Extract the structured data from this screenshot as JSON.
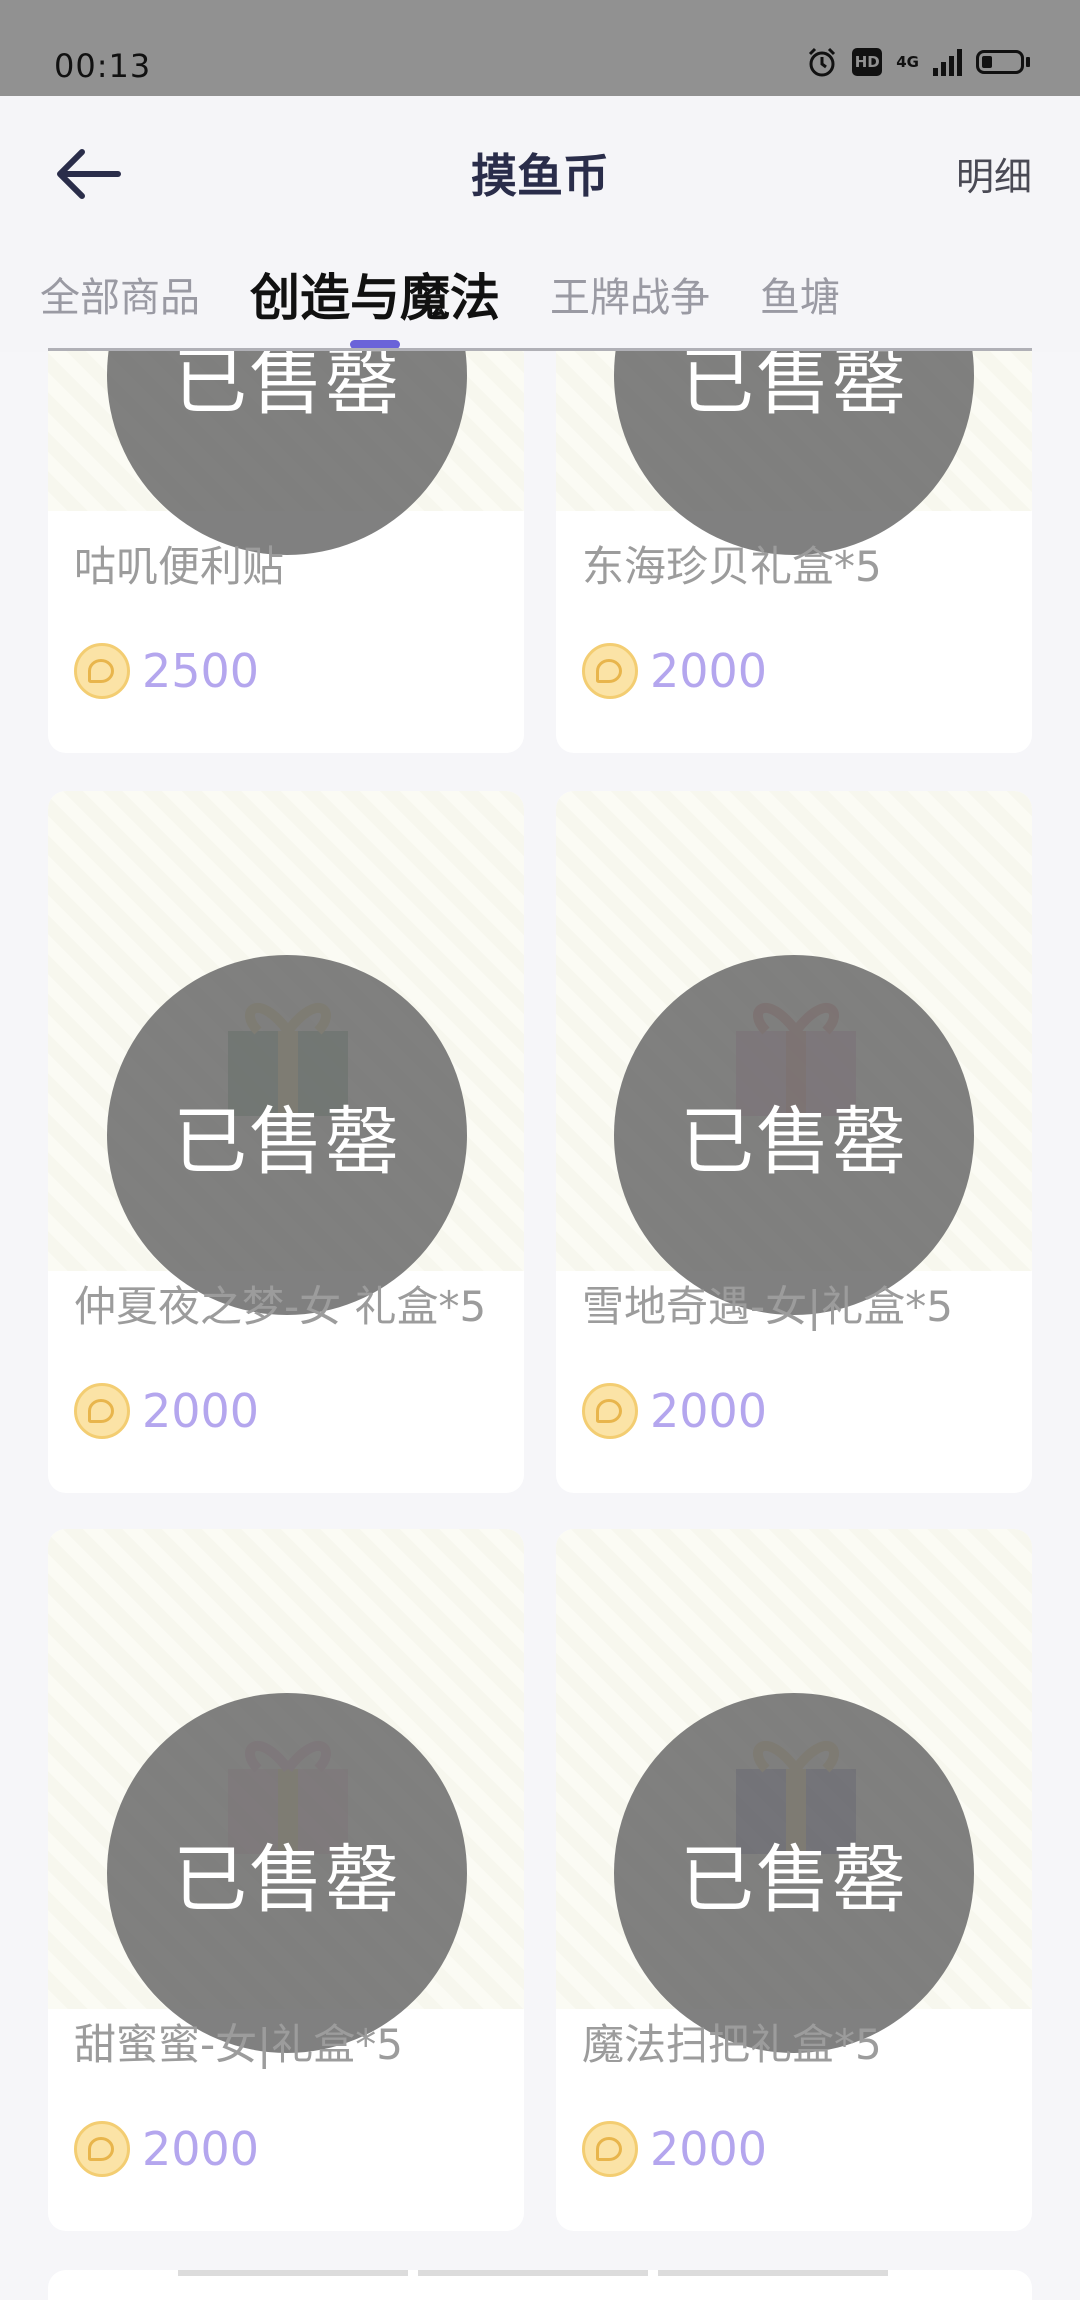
{
  "status_bar": {
    "time": "00:13",
    "hd": "HD",
    "network": "4G"
  },
  "header": {
    "title": "摸鱼币",
    "detail_link": "明细"
  },
  "tabs": [
    {
      "label": "全部商品",
      "active": false
    },
    {
      "label": "创造与魔法",
      "active": true
    },
    {
      "label": "王牌战争",
      "active": false
    },
    {
      "label": "鱼塘",
      "active": false
    }
  ],
  "products": [
    {
      "name": "咕叽便利贴",
      "price": "2500",
      "status": "已售罄"
    },
    {
      "name": "东海珍贝礼盒*5",
      "price": "2000",
      "status": "已售罄"
    },
    {
      "name": "仲夏夜之梦-女 礼盒*5",
      "price": "2000",
      "status": "已售罄"
    },
    {
      "name": "雪地奇遇-女|礼盒*5",
      "price": "2000",
      "status": "已售罄"
    },
    {
      "name": "甜蜜蜜-女|礼盒*5",
      "price": "2000",
      "status": "已售罄"
    },
    {
      "name": "魔法扫把礼盒*5",
      "price": "2000",
      "status": "已售罄"
    }
  ],
  "colors": {
    "accent": "#6a63d9",
    "price": "#b4a6ee",
    "sold_overlay": "#6e6e6e"
  }
}
